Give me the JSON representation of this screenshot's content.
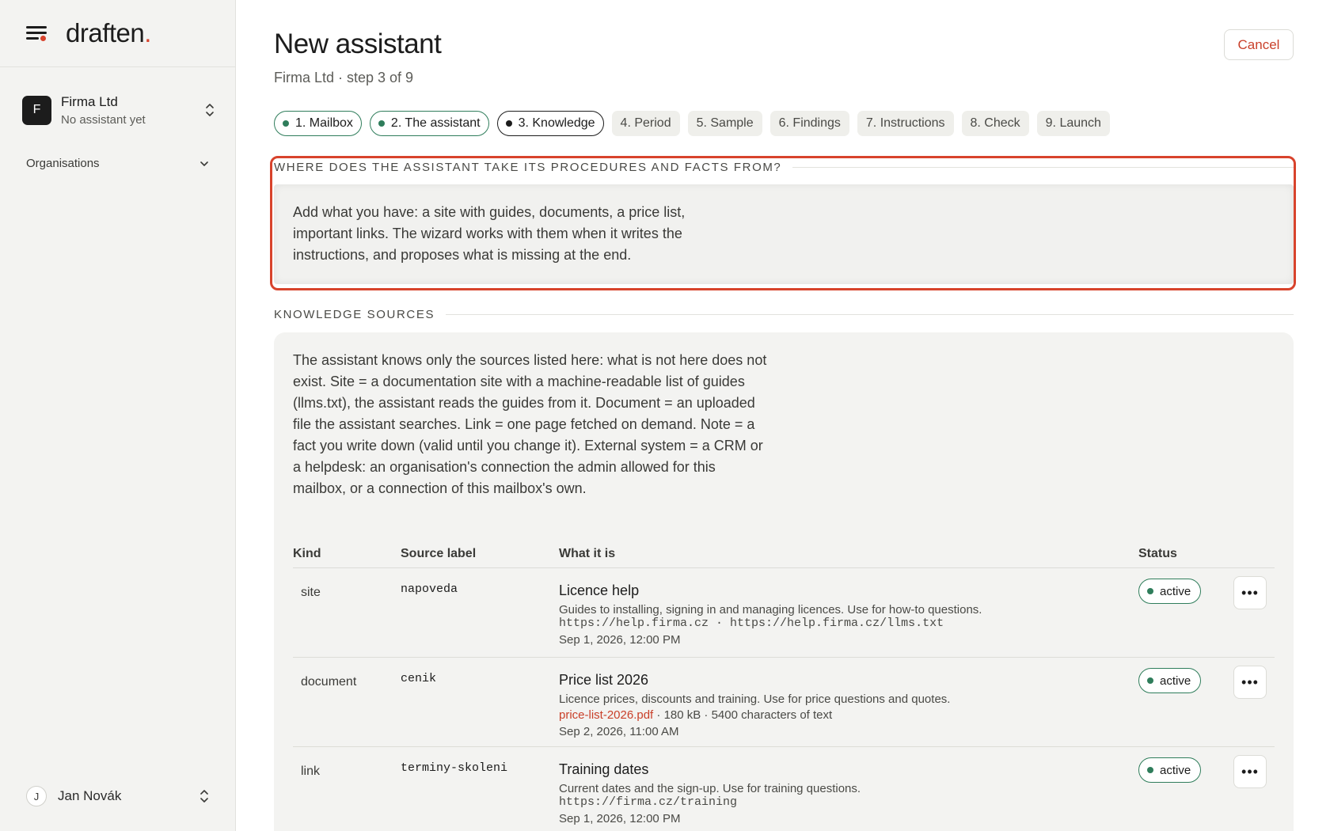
{
  "brand": {
    "logo_text": "draften",
    "logo_dot": ".",
    "menu_icon": "hamburger-icon"
  },
  "sidebar": {
    "org_initial": "F",
    "org_name": "Firma Ltd",
    "org_sub": "No assistant yet",
    "organisations_label": "Organisations",
    "user_initial": "J",
    "user_name": "Jan Novák"
  },
  "header": {
    "title": "New assistant",
    "subtitle": "Firma Ltd · step 3 of 9",
    "cancel_label": "Cancel"
  },
  "steps": [
    {
      "label": "1. Mailbox",
      "state": "done"
    },
    {
      "label": "2. The assistant",
      "state": "done"
    },
    {
      "label": "3. Knowledge",
      "state": "current"
    },
    {
      "label": "4. Period",
      "state": "pending"
    },
    {
      "label": "5. Sample",
      "state": "pending"
    },
    {
      "label": "6. Findings",
      "state": "pending"
    },
    {
      "label": "7. Instructions",
      "state": "pending"
    },
    {
      "label": "8. Check",
      "state": "pending"
    },
    {
      "label": "9. Launch",
      "state": "pending"
    }
  ],
  "intro": {
    "heading": "WHERE DOES THE ASSISTANT TAKE ITS PROCEDURES AND FACTS FROM?",
    "text": "Add what you have: a site with guides, documents, a price list, important links. The wizard works with them when it writes the instructions, and proposes what is missing at the end."
  },
  "sources": {
    "heading": "KNOWLEDGE SOURCES",
    "description": "The assistant knows only the sources listed here: what is not here does not exist. Site = a documentation site with a machine-readable list of guides (llms.txt), the assistant reads the guides from it. Document = an uploaded file the assistant searches. Link = one page fetched on demand. Note = a fact you write down (valid until you change it). External system = a CRM or a helpdesk: an organisation's connection the admin allowed for this mailbox, or a connection of this mailbox's own.",
    "columns": {
      "kind": "Kind",
      "label": "Source label",
      "what": "What it is",
      "status": "Status"
    },
    "rows": [
      {
        "kind": "site",
        "label": "napoveda",
        "title": "Licence help",
        "desc": "Guides to installing, signing in and managing licences. Use for how-to questions.",
        "meta": "https://help.firma.cz · https://help.firma.cz/llms.txt",
        "date": "Sep 1, 2026, 12:00 PM",
        "status": "active"
      },
      {
        "kind": "document",
        "label": "cenik",
        "title": "Price list 2026",
        "desc": "Licence prices, discounts and training. Use for price questions and quotes.",
        "file": "price-list-2026.pdf",
        "meta": " · 180 kB · 5400 characters of text",
        "date": "Sep 2, 2026, 11:00 AM",
        "status": "active"
      },
      {
        "kind": "link",
        "label": "terminy-skoleni",
        "title": "Training dates",
        "desc": "Current dates and the sign-up. Use for training questions.",
        "meta": "https://firma.cz/training",
        "date": "Sep 1, 2026, 12:00 PM",
        "status": "active"
      }
    ]
  },
  "colors": {
    "accent": "#d8432c",
    "success": "#2f7d5b",
    "dark": "#1c1c1c"
  }
}
